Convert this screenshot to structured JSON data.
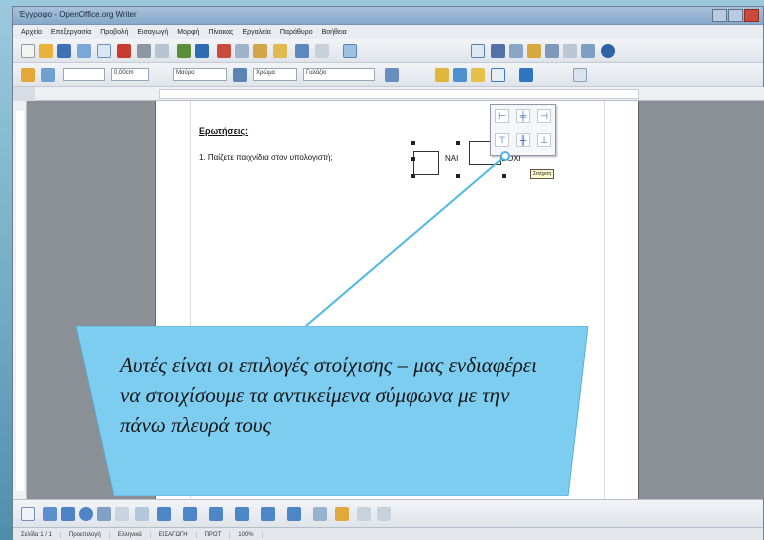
{
  "colors": {
    "callout_fill": "#7dcdf0",
    "callout_stroke": "#5aaed3",
    "pointer_line": "#4fb7e6",
    "page": "#ffffff",
    "workspace": "#8b8f96"
  },
  "window": {
    "title": "Έγγραφο - OpenOffice.org Writer"
  },
  "menubar": {
    "items": [
      "Αρχείο",
      "Επεξεργασία",
      "Προβολή",
      "Εισαγωγή",
      "Μορφή",
      "Πίνακας",
      "Εργαλεία",
      "Παράθυρο",
      "Βοήθεια"
    ]
  },
  "toolbar": {
    "line_width": "0,00cm",
    "color_name": "Μαύρο",
    "fill_name": "Χρώμα",
    "fill_color": "Γαλάζιο"
  },
  "document": {
    "heading": "Ερωτήσεις:",
    "question": "1. Παίζετε παιχνίδια στον υπολογιστή;",
    "option_yes": "ΝΑΙ",
    "option_no": "ΟΧΙ",
    "tooltip": "Στοίχιση"
  },
  "align_popup": {
    "icons": [
      "align-left-icon",
      "align-center-icon",
      "align-right-icon",
      "align-top-icon",
      "align-middle-icon",
      "align-bottom-icon"
    ]
  },
  "statusbar": {
    "page": "Σελίδα 1 / 1",
    "style": "Προεπιλογή",
    "language": "Ελληνικά",
    "mode": "ΕΙΣΑΓΩΓΗ",
    "selection": "ΠΡΟΤ",
    "zoom": "100%"
  },
  "callout": {
    "text": "Αυτές είναι οι επιλογές στοίχισης – μας ενδιαφέρει να στοιχίσουμε τα αντικείμενα σύμφωνα με την πάνω πλευρά τους"
  }
}
